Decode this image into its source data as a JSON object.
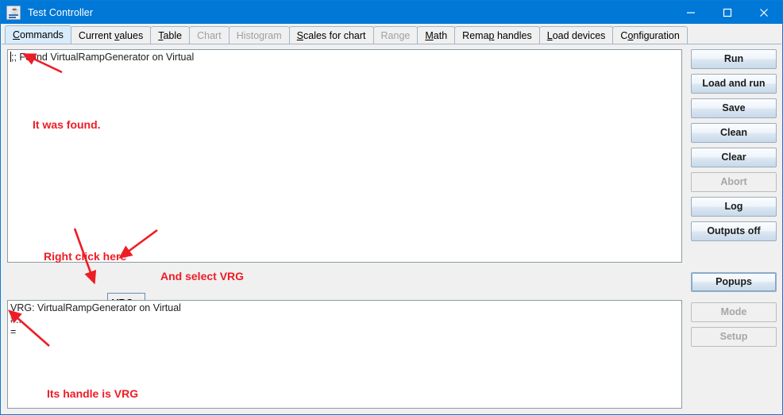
{
  "window": {
    "title": "Test Controller",
    "icon": "java-coffee-cup-icon",
    "minimize": "–",
    "maximize": "□",
    "close": "✕",
    "titlebar_color": "#0078d7"
  },
  "tabs": [
    {
      "label": "Commands",
      "mnemonic": "C",
      "selected": true,
      "enabled": true
    },
    {
      "label": "Current values",
      "mnemonic": "v",
      "selected": false,
      "enabled": true
    },
    {
      "label": "Table",
      "mnemonic": "T",
      "selected": false,
      "enabled": true
    },
    {
      "label": "Chart",
      "mnemonic": "",
      "selected": false,
      "enabled": false
    },
    {
      "label": "Histogram",
      "mnemonic": "",
      "selected": false,
      "enabled": false
    },
    {
      "label": "Scales for chart",
      "mnemonic": "S",
      "selected": false,
      "enabled": true
    },
    {
      "label": "Range",
      "mnemonic": "",
      "selected": false,
      "enabled": false
    },
    {
      "label": "Math",
      "mnemonic": "M",
      "selected": false,
      "enabled": true
    },
    {
      "label": "Remap handles",
      "mnemonic": "p",
      "selected": false,
      "enabled": true
    },
    {
      "label": "Load devices",
      "mnemonic": "L",
      "selected": false,
      "enabled": true
    },
    {
      "label": "Configuration",
      "mnemonic": "o",
      "selected": false,
      "enabled": true
    }
  ],
  "output_top": {
    "text": ";; Found VirtualRampGenerator on Virtual"
  },
  "output_bottom": {
    "text": "VRG: VirtualRampGenerator on Virtual\n#...\n="
  },
  "command_row": {
    "prompt_label": ":",
    "input_value": "",
    "input_placeholder": ""
  },
  "popup_menu": {
    "items": [
      {
        "label": "VRG"
      }
    ]
  },
  "buttons": [
    {
      "label": "Run",
      "enabled": true,
      "focused": false
    },
    {
      "label": "Load and run",
      "enabled": true,
      "focused": false
    },
    {
      "label": "Save",
      "enabled": true,
      "focused": false
    },
    {
      "label": "Clean",
      "enabled": true,
      "focused": false
    },
    {
      "label": "Clear",
      "enabled": true,
      "focused": false
    },
    {
      "label": "Abort",
      "enabled": false,
      "focused": false
    },
    {
      "label": "Log",
      "enabled": true,
      "focused": false
    },
    {
      "label": "Outputs off",
      "enabled": true,
      "focused": false
    },
    {
      "label": "Popups",
      "enabled": true,
      "focused": true
    },
    {
      "label": "Mode",
      "enabled": false,
      "focused": false
    },
    {
      "label": "Setup",
      "enabled": false,
      "focused": false
    }
  ],
  "annotations": {
    "color": "#ee1c25",
    "items": [
      {
        "text": "It was found."
      },
      {
        "text": "Right click here"
      },
      {
        "text": "And select VRG"
      },
      {
        "text": "Its handle is VRG"
      }
    ]
  }
}
